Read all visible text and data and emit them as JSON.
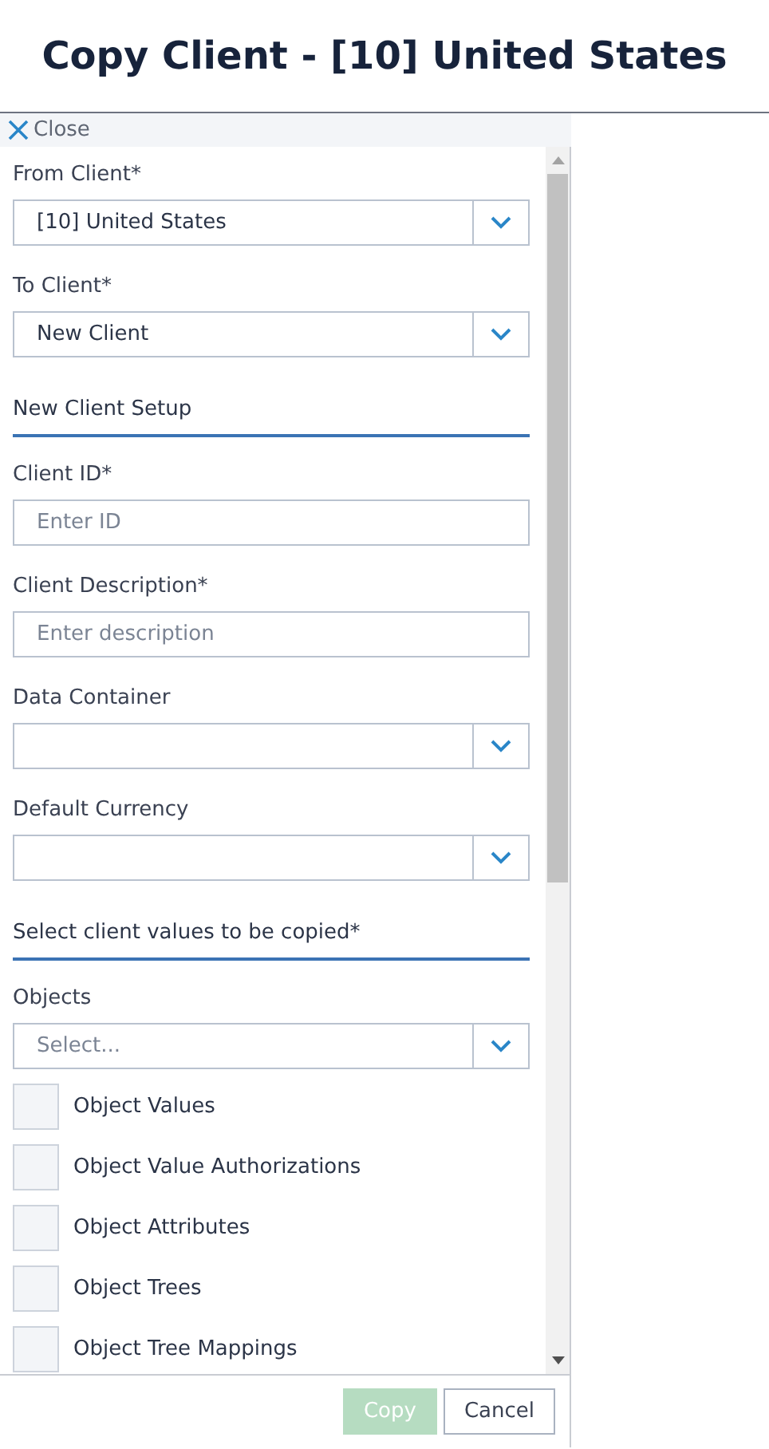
{
  "title": "Copy Client - [10] United States",
  "close": {
    "label": "Close"
  },
  "fields": [
    {
      "kind": "dropdown",
      "label": "From Client*",
      "value": "[10] United States"
    },
    {
      "kind": "dropdown",
      "label": "To Client*",
      "value": "New Client"
    },
    {
      "kind": "section",
      "label": "New Client Setup"
    },
    {
      "kind": "text",
      "label": "Client ID*",
      "placeholder": "Enter ID"
    },
    {
      "kind": "text",
      "label": "Client Description*",
      "placeholder": "Enter description"
    },
    {
      "kind": "dropdown",
      "label": "Data Container"
    },
    {
      "kind": "dropdown",
      "label": "Default Currency"
    },
    {
      "kind": "section",
      "label": "Select client values to be copied*"
    },
    {
      "kind": "dropdown",
      "label": "Objects",
      "placeholder": "Select..."
    }
  ],
  "checkboxes": [
    {
      "label": "Object Values",
      "checked": false
    },
    {
      "label": "Object Value Authorizations",
      "checked": false
    },
    {
      "label": "Object Attributes",
      "checked": false
    },
    {
      "label": "Object Trees",
      "checked": false
    },
    {
      "label": "Object Tree Mappings",
      "checked": false
    }
  ],
  "buttons": [
    {
      "label": "Copy",
      "kind": "primary",
      "disabled": true
    },
    {
      "label": "Cancel",
      "kind": "secondary",
      "disabled": false
    }
  ]
}
